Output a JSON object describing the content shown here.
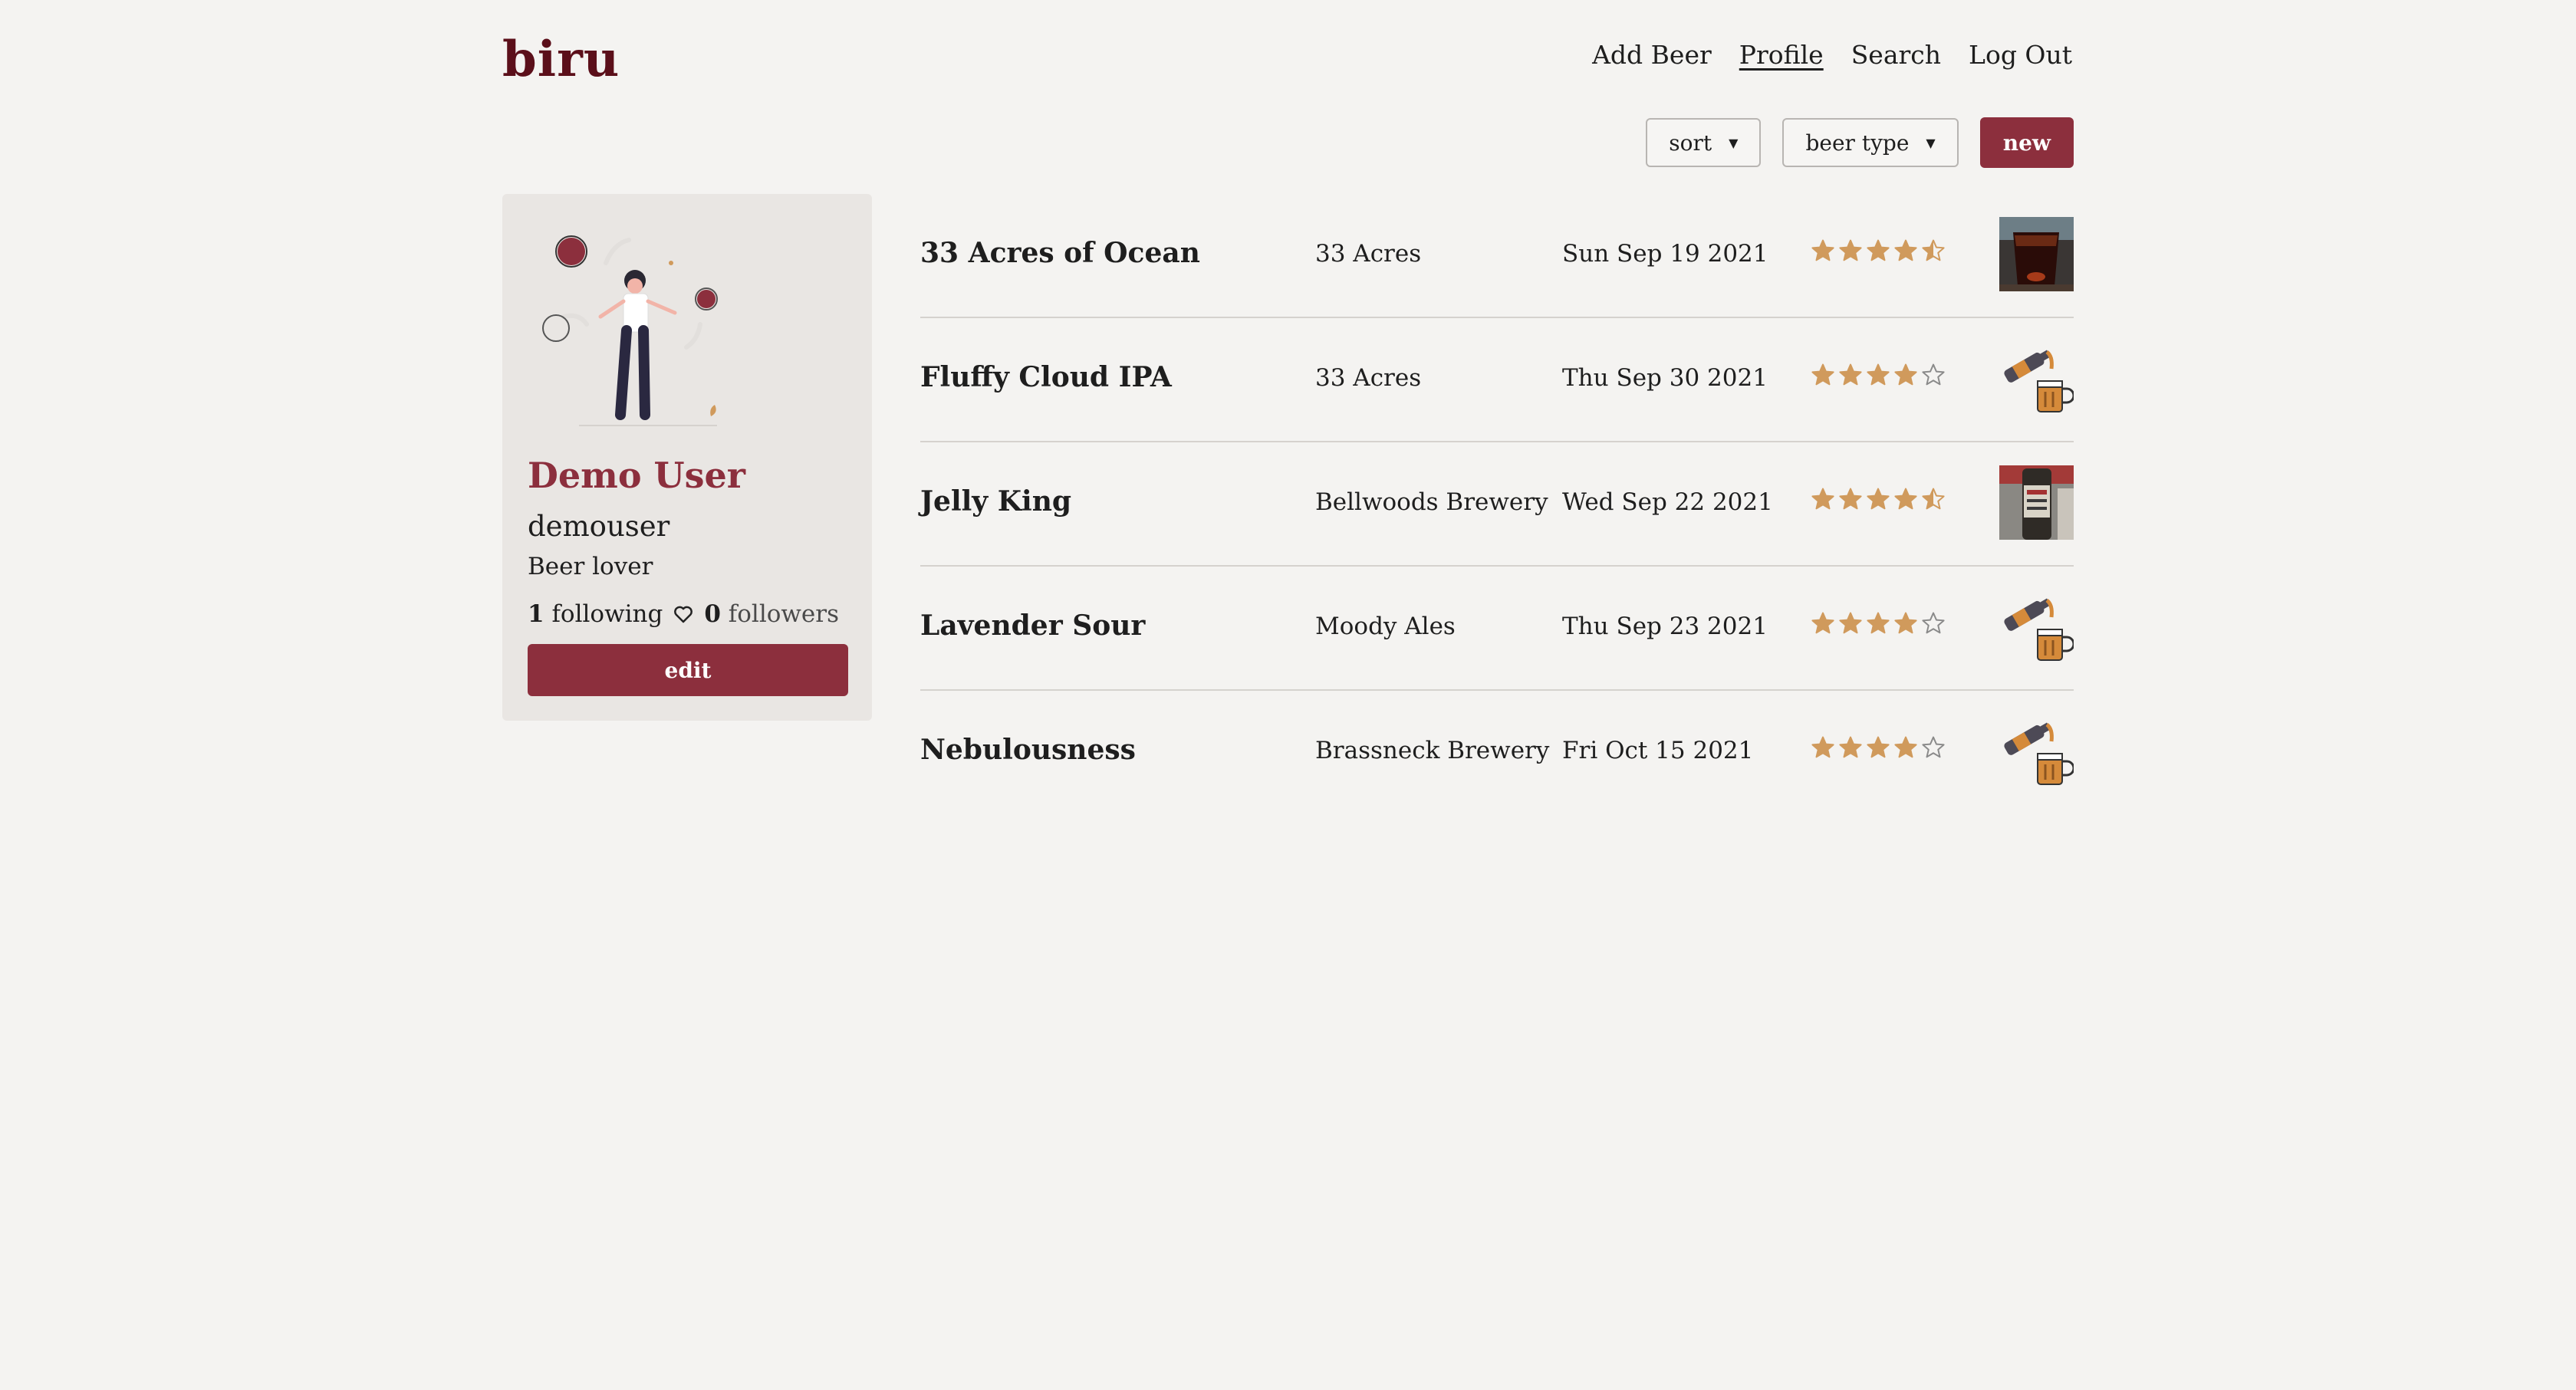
{
  "brand": {
    "logo": "biru",
    "accent": "#8c2f3d",
    "star_color": "#d09a5c"
  },
  "nav": {
    "add_beer": "Add Beer",
    "profile": "Profile",
    "search": "Search",
    "logout": "Log Out"
  },
  "toolbar": {
    "sort_label": "sort",
    "type_label": "beer type",
    "new_label": "new"
  },
  "profile": {
    "name": "Demo User",
    "username": "demouser",
    "bio": "Beer lover",
    "following_count": "1",
    "following_label": "following",
    "followers_count": "0",
    "followers_label": "followers",
    "edit_label": "edit"
  },
  "beers": [
    {
      "name": "33 Acres of Ocean",
      "brewery": "33 Acres",
      "date": "Sun Sep 19 2021",
      "rating": 4.5,
      "image": "dark-beer-photo"
    },
    {
      "name": "Fluffy Cloud IPA",
      "brewery": "33 Acres",
      "date": "Thu Sep 30 2021",
      "rating": 4,
      "image": "beer-pour-icon"
    },
    {
      "name": "Jelly King",
      "brewery": "Bellwoods Brewery",
      "date": "Wed Sep 22 2021",
      "rating": 4.5,
      "image": "bottle-photo"
    },
    {
      "name": "Lavender Sour",
      "brewery": "Moody Ales",
      "date": "Thu Sep 23 2021",
      "rating": 4,
      "image": "beer-pour-icon"
    },
    {
      "name": "Nebulousness",
      "brewery": "Brassneck Brewery",
      "date": "Fri Oct 15 2021",
      "rating": 4,
      "image": "beer-pour-icon"
    }
  ]
}
